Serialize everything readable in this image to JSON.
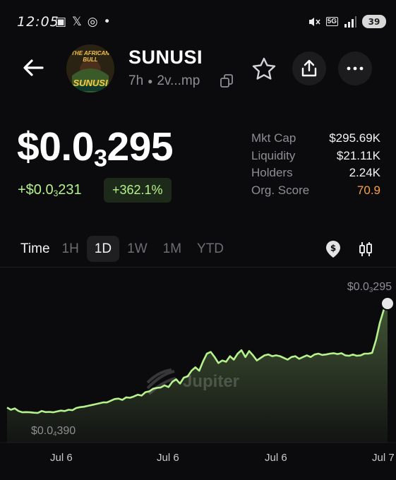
{
  "status_bar": {
    "time": "12:05",
    "left_icons": [
      "screen-record-icon",
      "x-icon",
      "whatsapp-icon",
      "dot-icon"
    ],
    "network": "5G",
    "battery": "39"
  },
  "header": {
    "token_name": "SUNUSI",
    "age": "7h",
    "address_short": "2v...mp",
    "avatar_text_top": "THE AFRICAN BULL",
    "avatar_text_bottom": "SUNUSI"
  },
  "price": {
    "prefix": "$0.0",
    "zeros": "3",
    "digits": "295",
    "change_prefix": "+$0.0",
    "change_zeros": "3",
    "change_digits": "231",
    "change_pct": "+362.1%"
  },
  "stats": [
    {
      "label": "Mkt Cap",
      "value": "$295.69K"
    },
    {
      "label": "Liquidity",
      "value": "$21.11K"
    },
    {
      "label": "Holders",
      "value": "2.24K"
    },
    {
      "label": "Org. Score",
      "value": "70.9"
    }
  ],
  "tabs": {
    "label": "Time",
    "items": [
      "1H",
      "1D",
      "1W",
      "1M",
      "YTD"
    ],
    "active": "1D"
  },
  "colors": {
    "accent_green": "#b5f28b",
    "score_orange": "#f5a14a",
    "background": "#0b0b0d"
  },
  "chart_data": {
    "type": "area",
    "watermark": "Jupiter",
    "high_label": {
      "prefix": "$0.0",
      "zeros": "3",
      "digits": "295"
    },
    "low_label": {
      "prefix": "$0.0",
      "zeros": "4",
      "digits": "390"
    },
    "x_ticks": [
      "Jul 6",
      "Jul 6",
      "Jul 6",
      "Jul 7"
    ],
    "x": [
      0,
      1,
      2,
      3,
      4,
      5,
      6,
      7,
      8,
      9,
      10,
      11,
      12,
      13,
      14,
      15,
      16,
      17,
      18,
      19,
      20,
      21,
      22,
      23,
      24,
      25,
      26,
      27,
      28,
      29,
      30,
      31,
      32,
      33,
      34,
      35,
      36,
      37,
      38,
      39,
      40,
      41,
      42,
      43,
      44,
      45,
      46,
      47,
      48,
      49,
      50,
      51,
      52,
      53,
      54,
      55,
      56,
      57,
      58,
      59,
      60,
      61,
      62,
      63,
      64,
      65,
      66,
      67,
      68,
      69,
      70,
      71,
      72,
      73,
      74,
      75,
      76,
      77,
      78,
      79,
      80,
      81,
      82,
      83,
      84,
      85,
      86,
      87,
      88,
      89,
      90,
      91,
      92,
      93,
      94,
      95,
      96,
      97,
      98,
      99
    ],
    "values": [
      5.2e-05,
      4.7e-05,
      5e-05,
      4.4e-05,
      4.1e-05,
      4.15e-05,
      4.1e-05,
      4e-05,
      3.95e-05,
      4.4e-05,
      4.15e-05,
      4.2e-05,
      4.1e-05,
      4.3e-05,
      4.5e-05,
      4.4e-05,
      4.7e-05,
      4.6e-05,
      5.1e-05,
      5.3e-05,
      5.4e-05,
      5.6e-05,
      5.8e-05,
      6e-05,
      6.2e-05,
      6.4e-05,
      6.4e-05,
      6.8e-05,
      7.2e-05,
      7.3e-05,
      7e-05,
      7.6e-05,
      7.5e-05,
      7.8e-05,
      8.2e-05,
      8e-05,
      8.8e-05,
      9e-05,
      9.6e-05,
      9.8e-05,
      9.9e-05,
      0.000104,
      0.0001,
      0.000112,
      0.000118,
      0.000108,
      0.000122,
      0.000125,
      0.000138,
      0.000146,
      0.000138,
      0.00016,
      0.000178,
      0.000182,
      0.00017,
      0.000156,
      0.000162,
      0.000159,
      0.000172,
      0.000164,
      0.000178,
      0.000186,
      0.00017,
      0.000184,
      0.000174,
      0.000162,
      0.000168,
      0.000174,
      0.000176,
      0.000172,
      0.000174,
      0.000172,
      0.000168,
      0.000164,
      0.00017,
      0.000172,
      0.000166,
      0.00017,
      0.000174,
      0.00017,
      0.000176,
      0.000178,
      0.000175,
      0.000176,
      0.000178,
      0.000179,
      0.000177,
      0.000179,
      0.000174,
      0.000173,
      0.000176,
      0.000173,
      0.000174,
      0.000178,
      0.000178,
      0.00018,
      0.00021,
      0.00025,
      0.00028,
      0.000295
    ],
    "ylim": [
      2e-05,
      0.00033
    ],
    "grid": false
  }
}
